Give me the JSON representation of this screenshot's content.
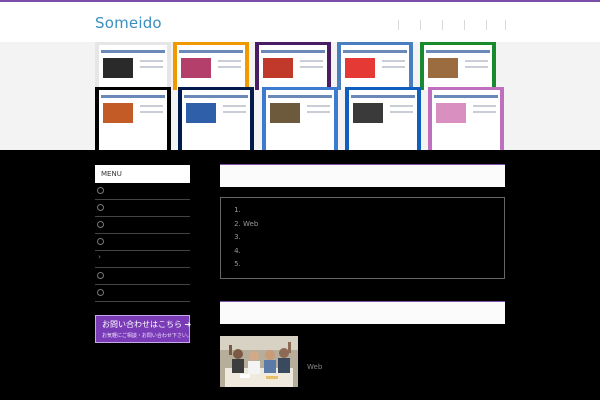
{
  "header": {
    "logo": "Someido",
    "nav_items": [
      "",
      "",
      "",
      "",
      "",
      ""
    ]
  },
  "banner": {
    "thumbnails": [
      {
        "name": "site-thumb-1",
        "frame": "#e6e6e6",
        "accent": "#2a2a2a"
      },
      {
        "name": "site-thumb-2",
        "frame": "#f19a00",
        "accent": "#b33f6a"
      },
      {
        "name": "site-thumb-3",
        "frame": "#4a1c63",
        "accent": "#c0392b"
      },
      {
        "name": "site-thumb-4",
        "frame": "#4a7fbf",
        "accent": "#e53935"
      },
      {
        "name": "site-thumb-5",
        "frame": "#1a8a2e",
        "accent": "#9a6c3f"
      },
      {
        "name": "site-thumb-6",
        "frame": "#000000",
        "accent": "#c25b26"
      },
      {
        "name": "site-thumb-7",
        "frame": "#001a4d",
        "accent": "#2f5fa8"
      },
      {
        "name": "site-thumb-8",
        "frame": "#3c7bd0",
        "accent": "#6d5a3c"
      },
      {
        "name": "site-thumb-9",
        "frame": "#0f5fbf",
        "accent": "#3a3a3a"
      },
      {
        "name": "site-thumb-10",
        "frame": "#c06fbf",
        "accent": "#d98fbf"
      }
    ]
  },
  "sidebar": {
    "menu_title": "MENU",
    "items": [
      {
        "label": "",
        "icon": "circle-arrow-icon"
      },
      {
        "label": "",
        "icon": "circle-arrow-icon"
      },
      {
        "label": "",
        "icon": "circle-arrow-icon"
      },
      {
        "label": "",
        "icon": "circle-arrow-icon"
      },
      {
        "label": "",
        "icon": "chevron-right-icon"
      },
      {
        "label": "",
        "icon": "circle-arrow-icon"
      },
      {
        "label": "",
        "icon": "circle-arrow-icon"
      }
    ],
    "contact": {
      "line1": "お問い合わせはこちら ➔",
      "line2": "お気軽にご相談・お問い合わせ下さい。"
    }
  },
  "main": {
    "section1_title": "",
    "list_items": [
      "",
      "Web",
      "",
      "",
      ""
    ],
    "section2_title": "",
    "photo_caption": "Web"
  },
  "colors": {
    "accent": "#7b4fa8",
    "logo": "#3a8fc0",
    "contact_bg": "#7a3bb7"
  }
}
